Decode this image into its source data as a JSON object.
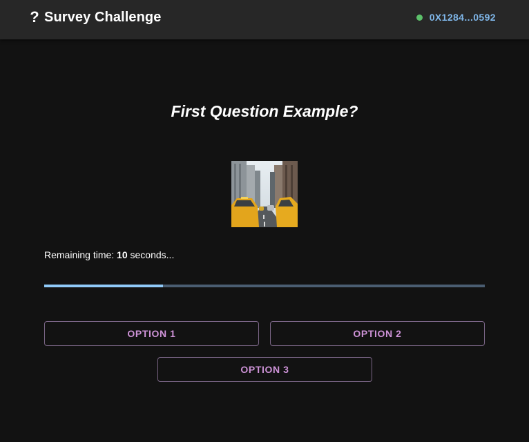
{
  "header": {
    "icon": "question-mark-icon",
    "title": "Survey Challenge",
    "wallet_status_color": "#5cc06a",
    "wallet_address": "0X1284...0592"
  },
  "question": {
    "text": "First Question Example?",
    "image": "city-street-taxis-photo"
  },
  "timer": {
    "prefix": "Remaining time: ",
    "seconds": "10",
    "suffix": " seconds...",
    "progress_percent": 27
  },
  "options": [
    {
      "label": "OPTION 1"
    },
    {
      "label": "OPTION 2"
    },
    {
      "label": "OPTION 3"
    }
  ],
  "colors": {
    "background": "#121212",
    "appbar": "#272727",
    "accent_blue": "#90caf9",
    "option_text": "#ce93d8"
  }
}
